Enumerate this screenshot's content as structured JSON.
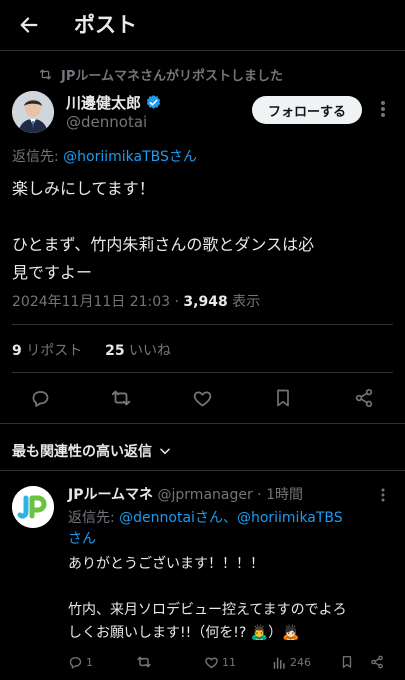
{
  "header": {
    "title": "ポスト"
  },
  "repost": {
    "text": "JPルームマネさんがリポストしました"
  },
  "tweet": {
    "author_name": "川邊健太郎",
    "author_handle": "@dennotai",
    "follow_label": "フォローする",
    "reply_to_prefix": "返信先: ",
    "reply_to_handle": "@horiimikaTBSさん",
    "body_lines": [
      "楽しみにしてます！",
      "",
      "ひとまず、竹内朱莉さんの歌とダンスは必",
      "見ですよー"
    ],
    "timestamp": "2024年11月11日 21:03 · ",
    "views_count": "3,948",
    "views_label": " 表示",
    "reposts_count": "9",
    "reposts_label": " リポスト",
    "likes_count": "25",
    "likes_label": " いいね"
  },
  "replies_sort": {
    "label": "最も関連性の高い返信"
  },
  "reply": {
    "name": "JPルームマネ",
    "handle": "@jprmanager",
    "time": "1時間",
    "reply_to_prefix": "返信先: ",
    "reply_to_handles": "@dennotaiさん、@horiimikaTBS",
    "reply_to_handles_2": "さん",
    "body_lines": [
      "ありがとうございます！！！！",
      "",
      "竹内、来月ソロデビュー控えてますのでよろ",
      "しくお願いします!!（何を!? 🙇‍♂️）🙇🏻"
    ],
    "reply_count": "1",
    "repost_count": "",
    "like_count": "11",
    "view_count": "246"
  },
  "colors": {
    "background": "#000000",
    "text": "#e7e9ea",
    "muted": "#71767b",
    "accent": "#1d9bf0",
    "verified": "#1d9bf0"
  },
  "icons": {
    "back": "arrow-left-icon",
    "repost_indicator": "repost-icon",
    "verified": "verified-badge-icon",
    "more": "more-vertical-icon",
    "reply": "reply-icon",
    "repost": "repost-icon",
    "like": "heart-icon",
    "bookmark": "bookmark-icon",
    "share": "share-icon",
    "views": "views-bar-icon",
    "chevron": "chevron-down-icon"
  }
}
